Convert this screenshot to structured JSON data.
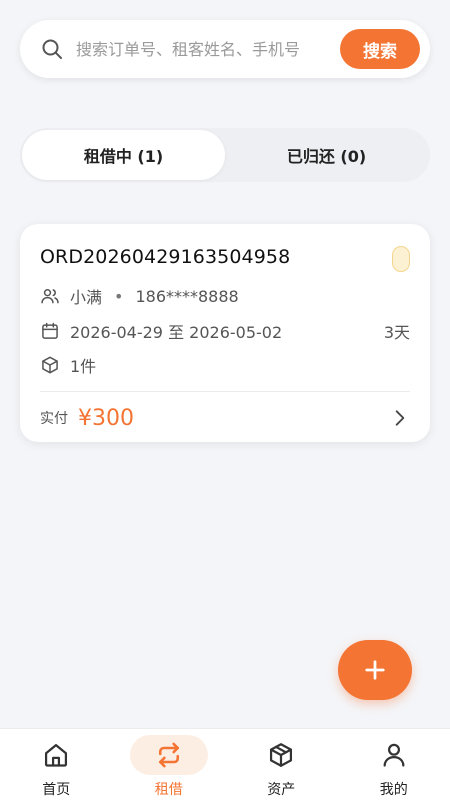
{
  "search": {
    "placeholder": "搜索订单号、租客姓名、手机号",
    "button_label": "搜索"
  },
  "tabs": [
    {
      "label": "租借中 (1)",
      "active": true
    },
    {
      "label": "已归还 (0)",
      "active": false
    }
  ],
  "order": {
    "order_number": "ORD20260429163504958",
    "renter_name": "小满",
    "separator": "•",
    "renter_phone": "186****8888",
    "date_range": "2026-04-29 至 2026-05-02",
    "duration": "3天",
    "item_count": "1件",
    "paid_label": "实付",
    "paid_amount": "¥300"
  },
  "fab": {
    "icon": "plus-icon"
  },
  "bottom_nav": {
    "items": [
      {
        "label": "首页",
        "icon": "home-icon",
        "active": false
      },
      {
        "label": "租借",
        "icon": "swap-icon",
        "active": true
      },
      {
        "label": "资产",
        "icon": "box-icon",
        "active": false
      },
      {
        "label": "我的",
        "icon": "user-icon",
        "active": false
      }
    ]
  },
  "colors": {
    "accent": "#f47433",
    "background": "#f4f5f8",
    "active_tab_bg": "#ffffff",
    "nav_active_bg": "#fdeee4"
  }
}
